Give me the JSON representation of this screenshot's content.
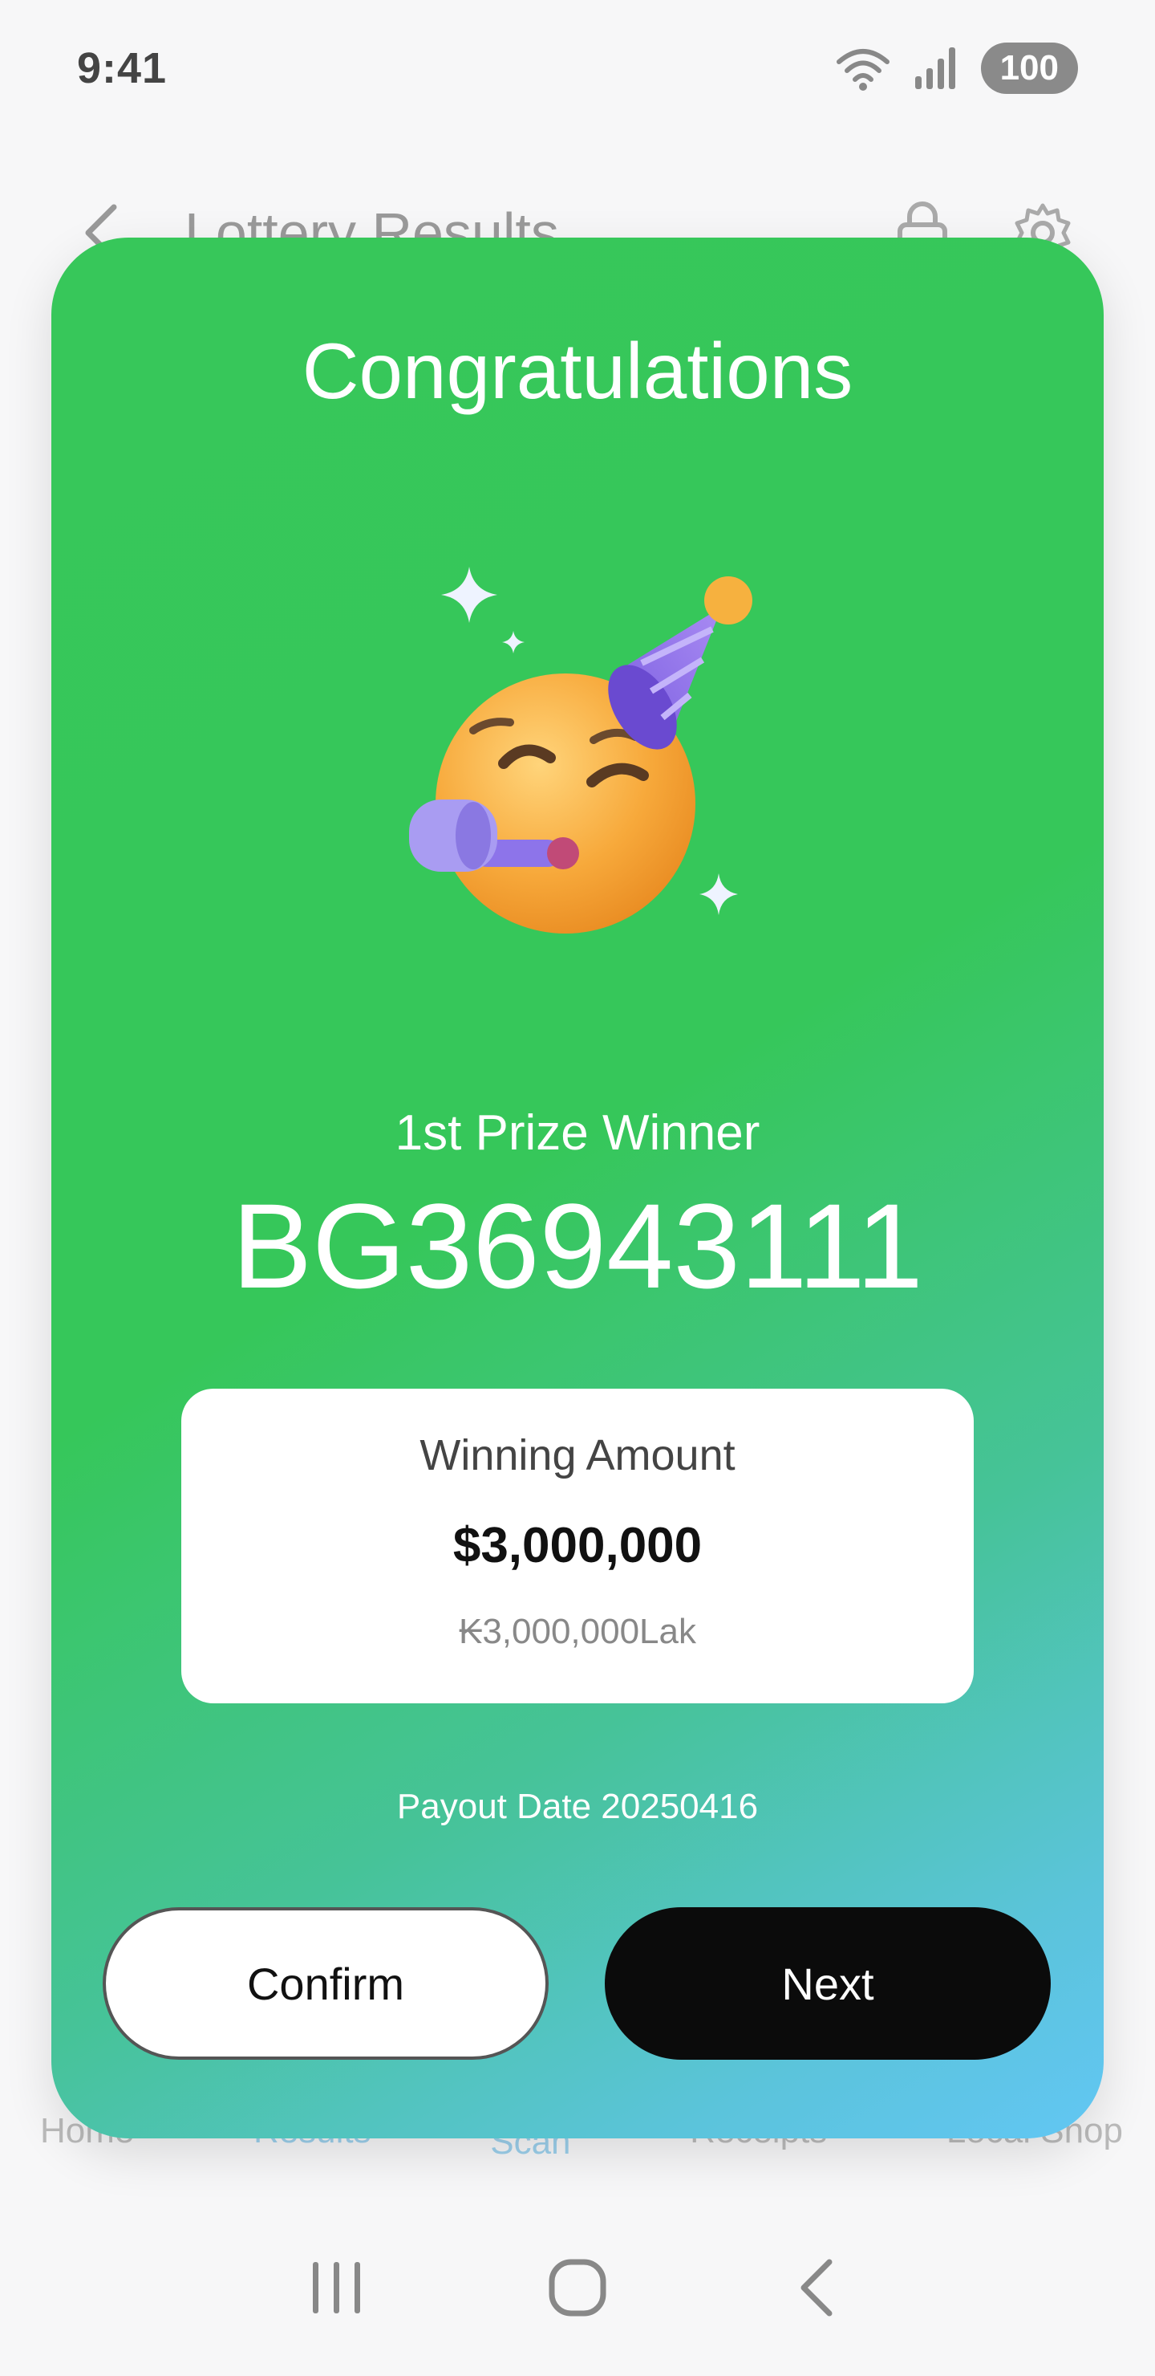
{
  "status_bar": {
    "time": "9:41",
    "battery": "100"
  },
  "header": {
    "title": "Lottery Results"
  },
  "bottom_nav": {
    "items": [
      {
        "label": "Home",
        "active": false
      },
      {
        "label": "Results",
        "active": true
      },
      {
        "label": "Scan",
        "active": false
      },
      {
        "label": "Receipts",
        "active": false
      },
      {
        "label": "Local Shop",
        "active": false
      }
    ]
  },
  "modal": {
    "title": "Congratulations",
    "illustration": "party-face-emoji",
    "prize_label": "1st Prize Winner",
    "ticket_number": "BG36943111",
    "amount_card": {
      "label": "Winning Amount",
      "usd": "$3,000,000",
      "lak": "₭3,000,000Lak"
    },
    "payout": "Payout Date 20250416",
    "confirm_label": "Confirm",
    "next_label": "Next"
  },
  "colors": {
    "modal_gradient_start": "#36c75a",
    "modal_gradient_end": "#62c6f4",
    "next_button": "#0b0b0b",
    "nav_active": "#9cd0ec"
  }
}
